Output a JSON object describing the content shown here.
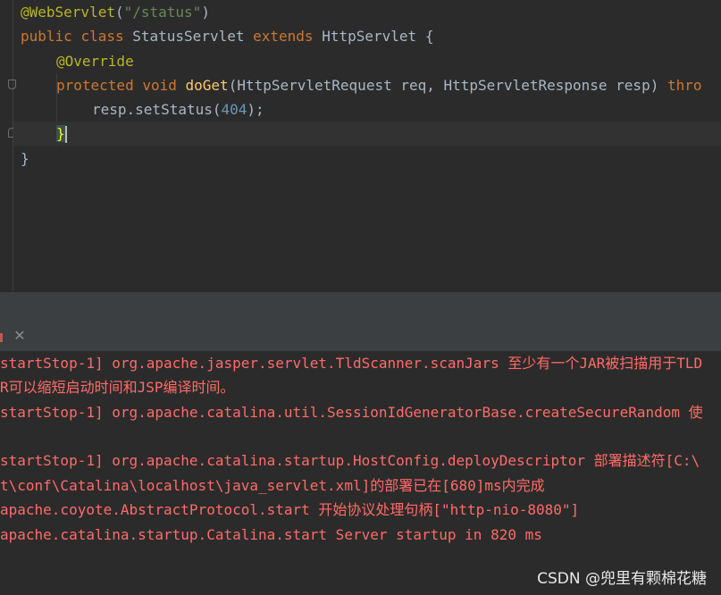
{
  "editor": {
    "lines": {
      "l1": {
        "annotation": "@WebServlet",
        "open_paren": "(",
        "string": "\"/status\"",
        "close_paren": ")"
      },
      "l2": {
        "kw_public": "public",
        "kw_class": "class",
        "class_name": "StatusServlet",
        "kw_extends": "extends",
        "super_name": "HttpServlet",
        "brace": "{"
      },
      "l3": {
        "annotation": "@Override"
      },
      "l4": {
        "kw_protected": "protected",
        "kw_void": "void",
        "method": "doGet",
        "params": "(HttpServletRequest req, HttpServletResponse resp)",
        "kw_throws": "thro"
      },
      "l5": {
        "call": "resp.setStatus(",
        "number": "404",
        "end": ");"
      },
      "l6": {
        "brace": "}"
      },
      "l7": {
        "brace": "}"
      }
    }
  },
  "console": {
    "lines": [
      "startStop-1] org.apache.jasper.servlet.TldScanner.scanJars 至少有一个JAR被扫描用于TLD",
      "R可以缩短启动时间和JSP编译时间。",
      "startStop-1] org.apache.catalina.util.SessionIdGeneratorBase.createSecureRandom 使",
      "startStop-1] org.apache.catalina.startup.HostConfig.deployDescriptor 部署描述符[C:\\",
      "t\\conf\\Catalina\\localhost\\java_servlet.xml]的部署已在[680]ms内完成",
      "apache.coyote.AbstractProtocol.start 开始协议处理句柄[\"http-nio-8080\"]",
      "apache.catalina.startup.Catalina.start Server startup in 820 ms"
    ]
  },
  "toolbar": {
    "close_glyph": "✕"
  },
  "watermark": "CSDN @兜里有颗棉花糖",
  "colors": {
    "background": "#2b2b2b",
    "keyword": "#cc7832",
    "annotation": "#bbb529",
    "string": "#6a8759",
    "method": "#ffc66d",
    "number": "#6897bb",
    "error_text": "#ff6b68"
  }
}
